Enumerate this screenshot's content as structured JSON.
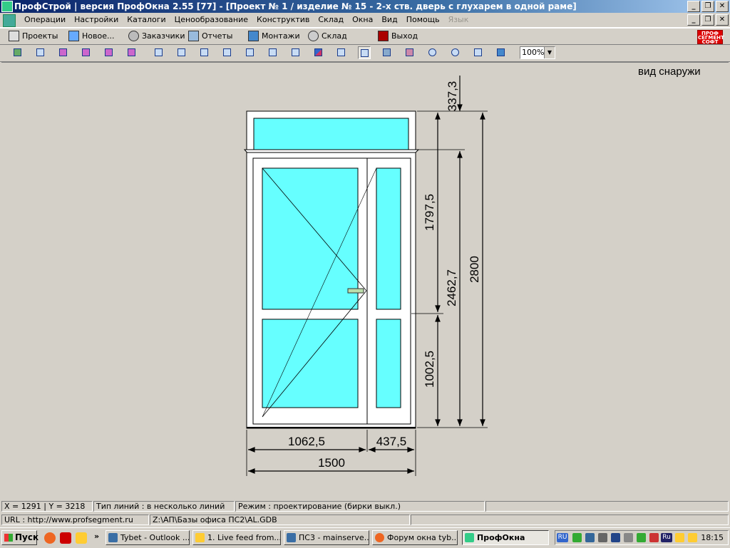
{
  "window": {
    "title": "ПрофСтрой | версия ПрофОкна  2.55 [77] - [Проект № 1 / изделие № 15  -  2-х ств. дверь с глухарем в одной раме]"
  },
  "menu": {
    "items": [
      "Операции",
      "Настройки",
      "Каталоги",
      "Ценообразование",
      "Конструктив",
      "Склад",
      "Окна",
      "Вид",
      "Помощь",
      "Язык"
    ],
    "disabled_item": "Язык"
  },
  "quickbar": {
    "projects": "Проекты",
    "new": "Новое...",
    "customers": "Заказчики",
    "reports": "Отчеты",
    "installs": "Монтажи",
    "warehouse": "Склад",
    "exit": "Выход",
    "logo_line1": "ПРОФ",
    "logo_line2": "СЕГМЕНТ",
    "logo_line3": "СОФТ"
  },
  "toolbar": {
    "zoom": "100%"
  },
  "drawing": {
    "view_label": "вид снаружи",
    "dims": {
      "top": "337,3",
      "middle": "1797,5",
      "bottom": "1002,5",
      "door": "2462,7",
      "total_height": "2800",
      "left_width": "1062,5",
      "right_width": "437,5",
      "total_width": "1500"
    }
  },
  "status": {
    "coords": "X = 1291 | Y = 3218",
    "line_type": "Тип линий : в несколько линий",
    "mode": "Режим : проектирование  (бирки выкл.)",
    "url": "URL : http://www.profsegment.ru",
    "db_path": "Z:\\АП\\Базы офиса ПС2\\AL.GDB"
  },
  "taskbar": {
    "start": "Пуск",
    "tasks": [
      "Tybet - Outlook ...",
      "1. Live feed from...",
      "ПС3 - mainserve...",
      "Форум окна tyb...",
      "ПрофОкна"
    ],
    "lang": "RU",
    "lang2": "Ru",
    "clock": "18:15"
  }
}
